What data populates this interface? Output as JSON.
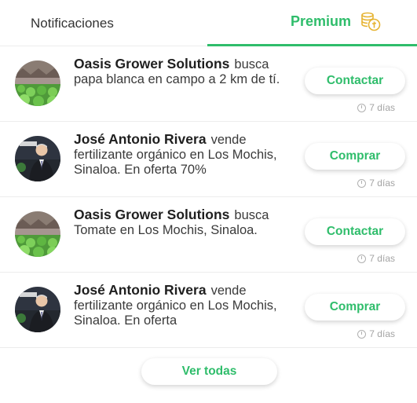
{
  "tabs": {
    "notifications": "Notificaciones",
    "premium": "Premium"
  },
  "colors": {
    "accent": "#2fbd6b",
    "premium_icon": "#e6b433"
  },
  "notifications": [
    {
      "avatar": "greenhouse-photo",
      "name": "Oasis Grower Solutions",
      "verb": "busca",
      "message": "papa blanca en campo a 2 km de tí.",
      "action": "Contactar",
      "time": "7 días"
    },
    {
      "avatar": "person-photo",
      "name": "José Antonio Rivera",
      "verb": "vende",
      "message": "fertilizante orgánico en Los Mochis, Sinaloa. En oferta 70%",
      "action": "Comprar",
      "time": "7 días"
    },
    {
      "avatar": "greenhouse-photo",
      "name": "Oasis Grower Solutions",
      "verb": "busca",
      "message": "Tomate en Los Mochis, Sinaloa.",
      "action": "Contactar",
      "time": "7 días"
    },
    {
      "avatar": "person-photo",
      "name": "José Antonio Rivera",
      "verb": "vende",
      "message": "fertilizante orgánico en Los Mochis, Sinaloa. En oferta",
      "action": "Comprar",
      "time": "7 días"
    }
  ],
  "footer": {
    "see_all": "Ver todas"
  }
}
